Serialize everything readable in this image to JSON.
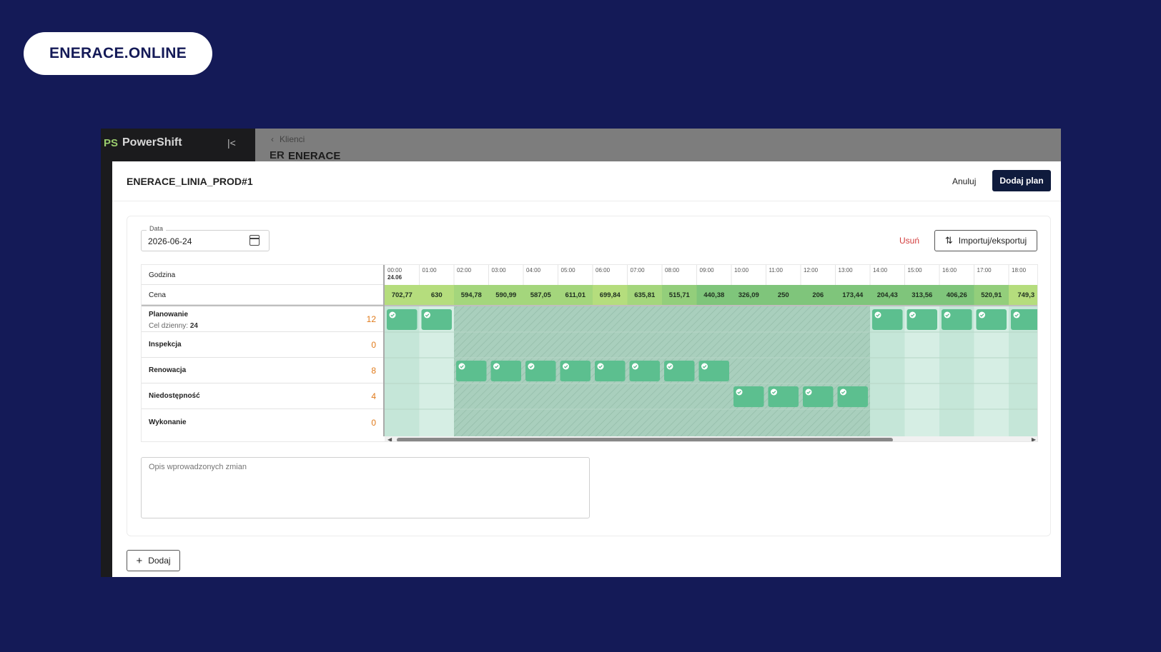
{
  "brand": {
    "pill_text": "ENERACE.ONLINE"
  },
  "sidebar": {
    "logo": "PS",
    "app_name": "PowerShift"
  },
  "header": {
    "back_label": "Klienci",
    "client_logo": "ER",
    "client_name": "ENERACE"
  },
  "modal": {
    "title": "ENERACE_LINIA_PROD#1",
    "cancel_label": "Anuluj",
    "submit_label": "Dodaj plan",
    "date": {
      "label": "Data",
      "value": "2026-06-24"
    },
    "remove_label": "Usuń",
    "import_label": "Importuj/eksportuj",
    "description_placeholder": "Opis wprowadzonych zmian",
    "add_label": "Dodaj"
  },
  "grid": {
    "hour_header": "Godzina",
    "price_header": "Cena",
    "first_day": "24.06",
    "hours": [
      "00:00",
      "01:00",
      "02:00",
      "03:00",
      "04:00",
      "05:00",
      "06:00",
      "07:00",
      "08:00",
      "09:00",
      "10:00",
      "11:00",
      "12:00",
      "13:00",
      "14:00",
      "15:00",
      "16:00",
      "17:00",
      "18:00"
    ],
    "prices": [
      "702,77",
      "630",
      "594,78",
      "590,99",
      "587,05",
      "611,01",
      "699,84",
      "635,81",
      "515,71",
      "440,38",
      "326,09",
      "250",
      "206",
      "173,44",
      "204,43",
      "313,56",
      "406,26",
      "520,91",
      "749,3"
    ],
    "price_colors": [
      "#b5dd7d",
      "#b5dd7d",
      "#a4d67c",
      "#a4d67c",
      "#a4d67c",
      "#a4d67c",
      "#b5dd7d",
      "#a4d67c",
      "#93ce7b",
      "#7fc57b",
      "#7fc57b",
      "#7fc57b",
      "#7fc57b",
      "#7fc57b",
      "#7fc57b",
      "#7fc57b",
      "#7fc57b",
      "#93ce7b",
      "#b5dd7d"
    ],
    "rows": [
      {
        "name": "Planowanie",
        "sub_label": "Cel dzienny:",
        "sub_value": "24",
        "count": "12",
        "blocks": [
          0,
          1,
          14,
          15,
          16,
          17,
          18
        ]
      },
      {
        "name": "Inspekcja",
        "count": "0",
        "blocks": []
      },
      {
        "name": "Renowacja",
        "count": "8",
        "blocks": [
          2,
          3,
          4,
          5,
          6,
          7,
          8,
          9
        ]
      },
      {
        "name": "Niedostępność",
        "count": "4",
        "blocks": [
          10,
          11,
          12,
          13
        ]
      },
      {
        "name": "Wykonanie",
        "count": "0",
        "blocks": []
      }
    ],
    "hatched_from_hour": 2,
    "hatched_to_hour": 13,
    "colors": {
      "block": "#5cbf8f",
      "cell_light": "#d6eee4",
      "cell_dark": "#c5e6d8",
      "hatch_bg": "#a9cfbd"
    }
  }
}
